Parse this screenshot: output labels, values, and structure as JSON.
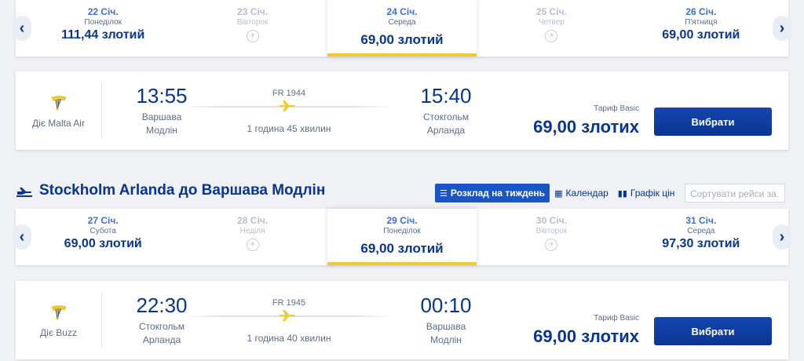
{
  "outbound": {
    "dates": [
      {
        "day": "22",
        "month": "Січ.",
        "weekday": "Понеділок",
        "price": "111,44 злотий",
        "state": "available"
      },
      {
        "day": "23",
        "month": "Січ.",
        "weekday": "Вівторок",
        "price": null,
        "state": "disabled"
      },
      {
        "day": "24",
        "month": "Січ.",
        "weekday": "Середа",
        "price": "69,00 злотий",
        "state": "selected"
      },
      {
        "day": "25",
        "month": "Січ.",
        "weekday": "Четвер",
        "price": null,
        "state": "disabled"
      },
      {
        "day": "26",
        "month": "Січ.",
        "weekday": "П'ятниця",
        "price": "69,00 злотий",
        "state": "available"
      }
    ],
    "flight": {
      "operator": "Діє Malta Air",
      "dep_time": "13:55",
      "dep_place_1": "Варшава",
      "dep_place_2": "Модлін",
      "flight_no": "FR 1944",
      "duration": "1 година 45 хвилин",
      "arr_time": "15:40",
      "arr_place_1": "Стокгольм",
      "arr_place_2": "Арланда",
      "fare_label": "Тариф Basic",
      "fare_price": "69,00 злотих",
      "select_label": "Вибрати"
    }
  },
  "inbound": {
    "title": "Stockholm Arlanda до Варшава Модлін",
    "tabs": [
      {
        "label": "Розклад на тиждень",
        "icon": "list-icon",
        "active": true
      },
      {
        "label": "Календар",
        "icon": "calendar-icon",
        "active": false
      },
      {
        "label": "Графік цін",
        "icon": "bar-chart-icon",
        "active": false
      }
    ],
    "sort_placeholder": "Сортувати рейси за",
    "dates": [
      {
        "day": "27",
        "month": "Січ.",
        "weekday": "Субота",
        "price": "69,00 злотий",
        "state": "available"
      },
      {
        "day": "28",
        "month": "Січ.",
        "weekday": "Неділя",
        "price": null,
        "state": "disabled"
      },
      {
        "day": "29",
        "month": "Січ.",
        "weekday": "Понеділок",
        "price": "69,00 злотий",
        "state": "selected"
      },
      {
        "day": "30",
        "month": "Січ.",
        "weekday": "Вівторок",
        "price": null,
        "state": "disabled"
      },
      {
        "day": "31",
        "month": "Січ.",
        "weekday": "Середа",
        "price": "97,30 злотий",
        "state": "available"
      }
    ],
    "flight": {
      "operator": "Діє Buzz",
      "dep_time": "22:30",
      "dep_place_1": "Стокгольм",
      "dep_place_2": "Арланда",
      "flight_no": "FR 1945",
      "duration": "1 година 40 хвилин",
      "arr_time": "00:10",
      "arr_place_1": "Варшава",
      "arr_place_2": "Модлін",
      "fare_label": "Тариф Basic",
      "fare_price": "69,00 злотих",
      "select_label": "Вибрати"
    }
  },
  "colors": {
    "brand_blue": "#073590",
    "accent_yellow": "#f1c933",
    "button_blue": "#1346b0"
  }
}
